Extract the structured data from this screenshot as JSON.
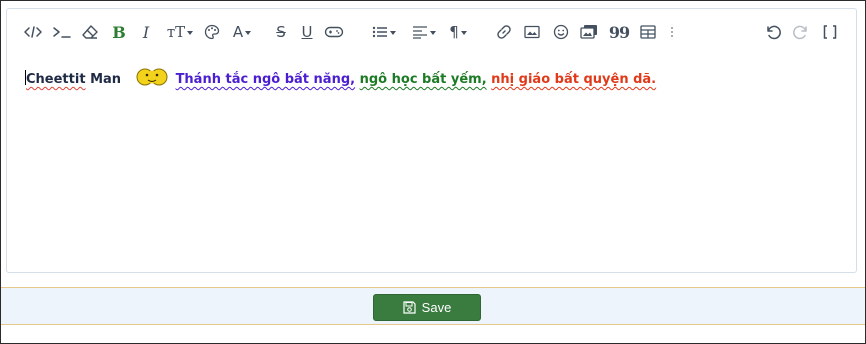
{
  "toolbar": {
    "buttons": [
      {
        "name": "code-icon",
        "tooltip": "Code"
      },
      {
        "name": "inline-code-icon",
        "tooltip": "Inline code"
      },
      {
        "name": "eraser-icon",
        "tooltip": "Remove formatting"
      },
      {
        "name": "bold-icon",
        "glyph": "B",
        "color": "#2e7d32"
      },
      {
        "name": "italic-icon",
        "glyph": "I"
      },
      {
        "name": "font-size-icon",
        "glyph": "тT"
      },
      {
        "name": "palette-icon"
      },
      {
        "name": "text-color-icon",
        "glyph": "A"
      },
      {
        "name": "strikethrough-icon",
        "glyph": "S"
      },
      {
        "name": "underline-icon",
        "glyph": "U"
      },
      {
        "name": "gamepad-icon"
      },
      {
        "name": "bullet-list-icon"
      },
      {
        "name": "align-icon"
      },
      {
        "name": "paragraph-icon",
        "glyph": "¶"
      },
      {
        "name": "link-icon"
      },
      {
        "name": "image-icon"
      },
      {
        "name": "smiley-icon"
      },
      {
        "name": "media-icon"
      },
      {
        "name": "quote-icon",
        "glyph": "99"
      },
      {
        "name": "table-icon"
      },
      {
        "name": "more-icon"
      },
      {
        "name": "undo-icon"
      },
      {
        "name": "redo-icon"
      },
      {
        "name": "fullscreen-icon",
        "glyph": "[ ]"
      }
    ]
  },
  "content": {
    "author": "Cheettit",
    "author_suffix": "Man",
    "emoji": "smiley-emoji",
    "segments": [
      {
        "text": "Thánh tắc ngô bất năng,",
        "color": "#4b1fd1"
      },
      {
        "text": "ngô học bất yếm,",
        "color": "#1d7a25"
      },
      {
        "text": "nhị giáo bất quyện dã.",
        "color": "#e03a1a"
      }
    ]
  },
  "footer": {
    "save_label": "Save",
    "save_color": "#3a7b40"
  }
}
